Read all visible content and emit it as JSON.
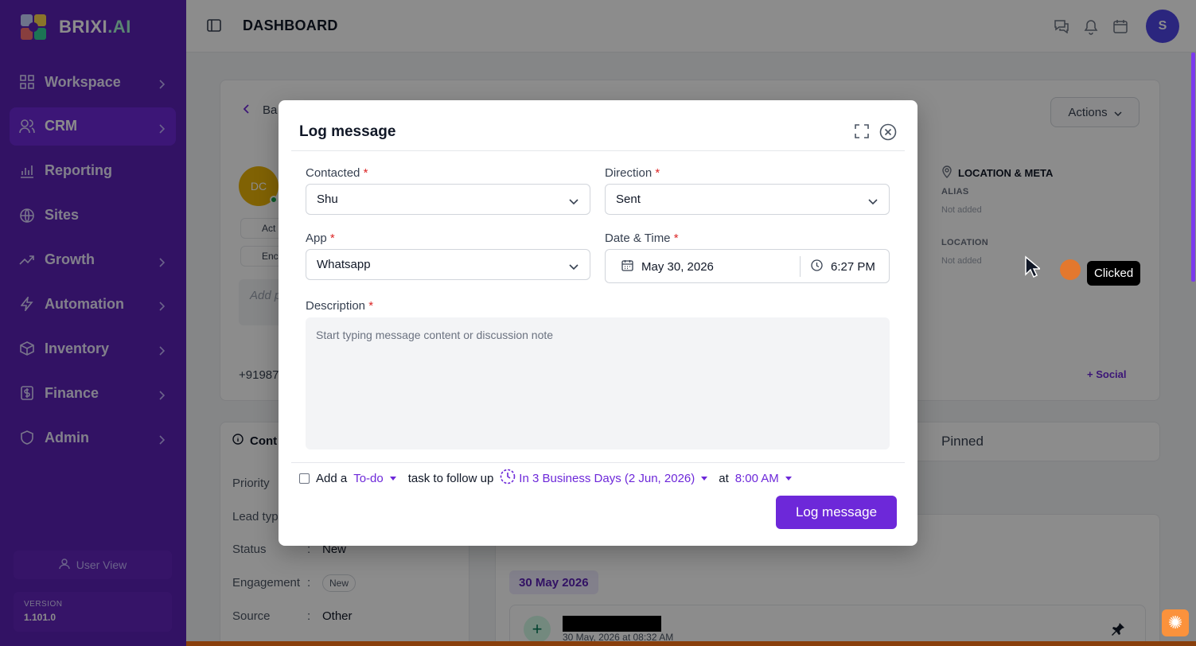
{
  "app": {
    "brand": "BRIXI",
    "brand_suffix": ".AI",
    "page_title": "DASHBOARD",
    "user_initial": "S"
  },
  "sidebar": {
    "items": [
      {
        "label": "Workspace",
        "icon": "grid-icon",
        "has_chevron": true
      },
      {
        "label": "CRM",
        "icon": "users-icon",
        "has_chevron": true,
        "active": true
      },
      {
        "label": "Reporting",
        "icon": "bar-chart-icon",
        "has_chevron": false
      },
      {
        "label": "Sites",
        "icon": "globe-icon",
        "has_chevron": false
      },
      {
        "label": "Growth",
        "icon": "trending-up-icon",
        "has_chevron": true
      },
      {
        "label": "Automation",
        "icon": "bolt-icon",
        "has_chevron": true
      },
      {
        "label": "Inventory",
        "icon": "box-icon",
        "has_chevron": true
      },
      {
        "label": "Finance",
        "icon": "dollar-icon",
        "has_chevron": true
      },
      {
        "label": "Admin",
        "icon": "shield-icon",
        "has_chevron": true
      }
    ],
    "user_view_label": "User View",
    "version_label": "VERSION",
    "version_value": "1.101.0"
  },
  "background": {
    "back_label": "Ba",
    "actions_label": "Actions",
    "avatar_initials": "DC",
    "chip_1": "Act",
    "chip_2": "Enc",
    "add_placeholder": "Add p",
    "meta_title": "LOCATION & META",
    "alias_label": "ALIAS",
    "alias_value": "Not added",
    "location_label": "LOCATION",
    "location_value": "Not added",
    "phone": "+91987",
    "social_label": "+ Social",
    "cont_tab": "Cont",
    "pinned_tab": "Pinned",
    "fields": [
      {
        "label": "Priority",
        "value": ""
      },
      {
        "label": "Lead typ",
        "value": ""
      },
      {
        "label": "Status",
        "value": "New"
      },
      {
        "label": "Engagement",
        "value": "New"
      },
      {
        "label": "Source",
        "value": "Other"
      }
    ],
    "date_badge": "30 May 2026",
    "timeline_date": "30 May, 2026 at 08:32 AM"
  },
  "tooltip": {
    "label": "Clicked"
  },
  "modal": {
    "title": "Log message",
    "contacted": {
      "label": "Contacted",
      "value": "Shu"
    },
    "direction": {
      "label": "Direction",
      "value": "Sent"
    },
    "app": {
      "label": "App",
      "value": "Whatsapp"
    },
    "datetime": {
      "label": "Date & Time",
      "date": "May 30, 2026",
      "time": "6:27 PM"
    },
    "description": {
      "label": "Description",
      "placeholder": "Start typing message content or discussion note"
    },
    "followup": {
      "prefix": "Add a",
      "task_type": "To-do",
      "middle": "task to follow up",
      "when": "In 3 Business Days (2 Jun, 2026)",
      "at": "at",
      "time": "8:00 AM"
    },
    "submit_label": "Log message"
  },
  "colors": {
    "sidebar_bg": "#5b21b6",
    "accent": "#6d28d9",
    "required": "#dc2626"
  }
}
